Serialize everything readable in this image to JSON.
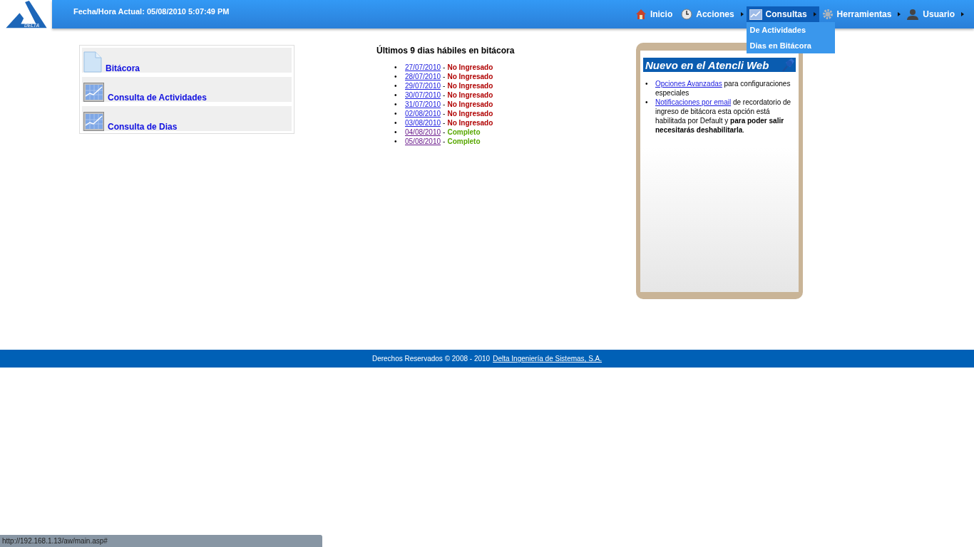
{
  "header": {
    "logo_text": "DELTA",
    "datetime": "Fecha/Hora Actual: 05/08/2010 5:07:49 PM"
  },
  "menu": [
    {
      "label": "Inicio",
      "kind": "home",
      "selected": false,
      "submenu": false
    },
    {
      "label": "Acciones",
      "kind": "clock",
      "selected": false,
      "submenu": true
    },
    {
      "label": "Consultas",
      "kind": "chart",
      "selected": true,
      "submenu": true,
      "dropdown": [
        "De Actividades",
        "Dias en Bitácora"
      ]
    },
    {
      "label": "Herramientas",
      "kind": "gear",
      "selected": false,
      "submenu": true
    },
    {
      "label": "Usuario",
      "kind": "user",
      "selected": false,
      "submenu": true
    }
  ],
  "shortcuts": [
    {
      "label": "Bitácora",
      "kind": "document"
    },
    {
      "label": "Consulta de Actividades",
      "kind": "chart"
    },
    {
      "label": "Consulta de Dias",
      "kind": "chart"
    }
  ],
  "days": {
    "title": "Últimos 9 dias hábiles en bitácora",
    "bullet": "•",
    "separator": "-",
    "items": [
      {
        "date": "27/07/2010",
        "status": "No Ingresado",
        "complete": false,
        "visited": false
      },
      {
        "date": "28/07/2010",
        "status": "No Ingresado",
        "complete": false,
        "visited": false
      },
      {
        "date": "29/07/2010",
        "status": "No Ingresado",
        "complete": false,
        "visited": false
      },
      {
        "date": "30/07/2010",
        "status": "No Ingresado",
        "complete": false,
        "visited": false
      },
      {
        "date": "31/07/2010",
        "status": "No Ingresado",
        "complete": false,
        "visited": false
      },
      {
        "date": "02/08/2010",
        "status": "No Ingresado",
        "complete": false,
        "visited": false
      },
      {
        "date": "03/08/2010",
        "status": "No Ingresado",
        "complete": false,
        "visited": false
      },
      {
        "date": "04/08/2010",
        "status": "Completo",
        "complete": true,
        "visited": true
      },
      {
        "date": "05/08/2010",
        "status": "Completo",
        "complete": true,
        "visited": true
      }
    ]
  },
  "news": {
    "title": "Nuevo en el Atencli Web",
    "bullet": "•",
    "items": [
      {
        "link": "Opciones Avanzadas",
        "text": "para configuraciones especiales"
      },
      {
        "link": "Notificaciones por email",
        "text": "de recordatorio de ingreso de bitácora esta opción está habilitada por Default y **para poder salir necesitarás deshabilitarla**."
      }
    ]
  },
  "footer": {
    "text": "Derechos Reservados © 2008 - 2010",
    "link": "Delta Ingeniería de Sistemas, S.A."
  },
  "status_bar": {
    "url": "http://192.168.1.13/aw/main.asp#"
  }
}
